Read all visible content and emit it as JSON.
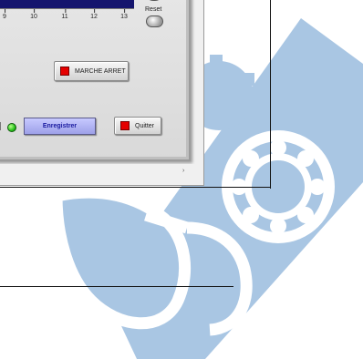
{
  "panel": {
    "x_ticks": [
      "9",
      "10",
      "11",
      "12",
      "13"
    ],
    "reset_label": "Reset",
    "marche_arret_label": "MARCHE ARRET",
    "enregistrer_label": "Enregistrer",
    "quitter_label": "Quitter"
  },
  "icons": {
    "scroll_right": "›",
    "dropdown": "▾"
  },
  "colors": {
    "plot_background": "#15156e",
    "led_red": "#e50000",
    "led_green": "#27c21c",
    "enregistrer_button": "#b4b6f6",
    "background_art": "#a9c6e3"
  }
}
